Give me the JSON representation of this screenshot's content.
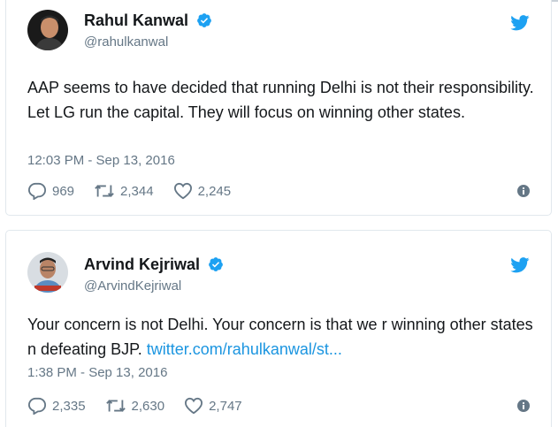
{
  "tweets": [
    {
      "name": "Rahul Kanwal",
      "handle": "@rahulkanwal",
      "text": "AAP seems to have decided that running Delhi is not their responsibility. Let LG run the capital. They will focus on winning other states.",
      "link": "",
      "time": "12:03 PM - Sep 13, 2016",
      "replies": "969",
      "retweets": "2,344",
      "likes": "2,245"
    },
    {
      "name": "Arvind Kejriwal",
      "handle": "@ArvindKejriwal",
      "text": "Your concern is not Delhi. Your concern is that we r winning other states n defeating BJP. ",
      "link": "twitter.com/rahulkanwal/st...",
      "time": "1:38 PM - Sep 13, 2016",
      "replies": "2,335",
      "retweets": "2,630",
      "likes": "2,747"
    }
  ],
  "colors": {
    "verified": "#1da1f2",
    "link": "#1b95e0",
    "meta": "#657786",
    "border": "#e1e8ed"
  },
  "icons": [
    "verified-badge-icon",
    "twitter-bird-icon",
    "reply-icon",
    "retweet-icon",
    "like-icon",
    "info-icon"
  ]
}
